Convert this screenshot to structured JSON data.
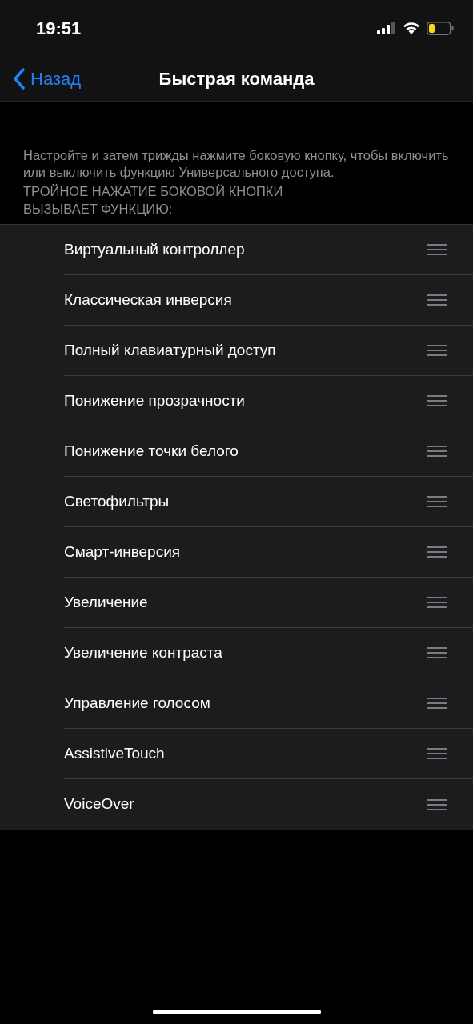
{
  "status_bar": {
    "time": "19:51"
  },
  "nav": {
    "back": "Назад",
    "title": "Быстрая команда"
  },
  "description": "Настройте и затем трижды нажмите боковую кнопку, чтобы включить или выключить функцию Универсального доступа.",
  "section_header": "ТРОЙНОЕ НАЖАТИЕ БОКОВОЙ КНОПКИ ВЫЗЫВАЕТ ФУНКЦИЮ:",
  "items": [
    {
      "label": "Виртуальный контроллер"
    },
    {
      "label": "Классическая инверсия"
    },
    {
      "label": "Полный клавиатурный доступ"
    },
    {
      "label": "Понижение прозрачности"
    },
    {
      "label": "Понижение точки белого"
    },
    {
      "label": "Светофильтры"
    },
    {
      "label": "Смарт-инверсия"
    },
    {
      "label": "Увеличение"
    },
    {
      "label": "Увеличение контраста"
    },
    {
      "label": "Управление голосом"
    },
    {
      "label": "AssistiveTouch"
    },
    {
      "label": "VoiceOver"
    }
  ]
}
